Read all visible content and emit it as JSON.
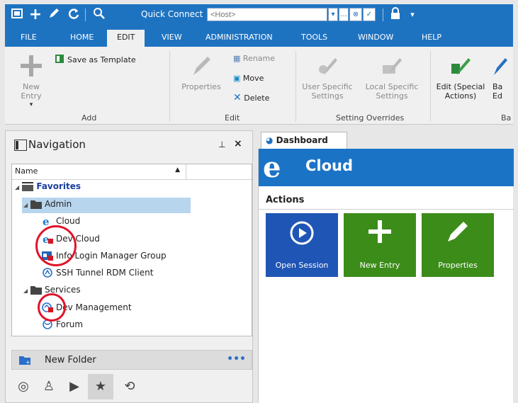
{
  "quickbar": {
    "quick_connect_label": "Quick Connect",
    "host_placeholder": "<Host>"
  },
  "menu": {
    "items": [
      "FILE",
      "HOME",
      "EDIT",
      "VIEW",
      "ADMINISTRATION",
      "TOOLS",
      "WINDOW",
      "HELP"
    ],
    "active": "EDIT"
  },
  "ribbon": {
    "new_entry": "New Entry",
    "save_as_template": "Save as Template",
    "add_group": "Add",
    "properties": "Properties",
    "rename": "Rename",
    "move": "Move",
    "delete": "Delete",
    "edit_group": "Edit",
    "user_specific_settings": "User Specific Settings",
    "local_specific_settings": "Local Specific Settings",
    "setting_overrides_group": "Setting Overrides",
    "edit_special_actions": "Edit (Special Actions)",
    "batch_edit_partial": "Ba Ed",
    "batch_group_partial": "Ba"
  },
  "navigation": {
    "title": "Navigation",
    "column_name": "Name",
    "tree": [
      {
        "label": "Favorites",
        "level": 0,
        "icon": "folder-stack-icon",
        "bold": true
      },
      {
        "label": "Admin",
        "level": 1,
        "icon": "folder-icon",
        "selected": true
      },
      {
        "label": "Cloud",
        "level": 2,
        "icon": "ie-icon"
      },
      {
        "label": "Dev Cloud",
        "level": 2,
        "icon": "ie-icon-locked"
      },
      {
        "label": "Info Login Manager Group",
        "level": 2,
        "icon": "credential-group-icon-locked"
      },
      {
        "label": "SSH Tunnel RDM Client",
        "level": 2,
        "icon": "ssh-tunnel-icon"
      },
      {
        "label": "Services",
        "level": 1,
        "icon": "folder-icon"
      },
      {
        "label": "Dev Management",
        "level": 2,
        "icon": "management-icon-locked"
      },
      {
        "label": "Forum",
        "level": 2,
        "icon": "globe-icon"
      }
    ],
    "new_folder": "New Folder"
  },
  "dashboard": {
    "tab_label": "Dashboard",
    "title": "Cloud",
    "actions_label": "Actions",
    "tiles": [
      {
        "label": "Open Session",
        "color": "#1f55b5"
      },
      {
        "label": "New Entry",
        "color": "#3c8c1a"
      },
      {
        "label": "Properties",
        "color": "#3c8c1a"
      }
    ]
  },
  "colors": {
    "titlebar": "#1e73c1",
    "accent_red": "#e0142a"
  }
}
